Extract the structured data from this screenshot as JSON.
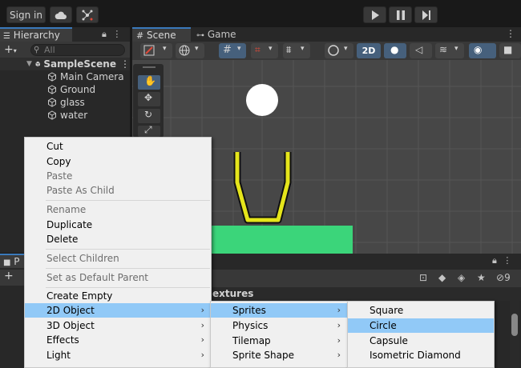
{
  "toolbar": {
    "signin_label": "Sign in",
    "cloud_icon": "cloud-icon",
    "collab_icon": "collab-icon",
    "play_icon": "play-icon",
    "pause_icon": "pause-icon",
    "step_icon": "step-icon"
  },
  "hierarchy": {
    "tab_label": "Hierarchy",
    "search_placeholder": "All",
    "scene_name": "SampleScene",
    "items": [
      {
        "label": "Main Camera"
      },
      {
        "label": "Ground"
      },
      {
        "label": "glass"
      },
      {
        "label": "water"
      }
    ]
  },
  "scene": {
    "tab_scene": "Scene",
    "tab_game": "Game",
    "mode_2d": "2D"
  },
  "project": {
    "tab_label": "P",
    "folder_label": "extures",
    "count_label": "9"
  },
  "context_menu": {
    "items": [
      {
        "label": "Cut",
        "disabled": false
      },
      {
        "label": "Copy",
        "disabled": false
      },
      {
        "label": "Paste",
        "disabled": true
      },
      {
        "label": "Paste As Child",
        "disabled": true
      },
      {
        "label": "Rename",
        "disabled": true
      },
      {
        "label": "Duplicate",
        "disabled": false
      },
      {
        "label": "Delete",
        "disabled": false
      },
      {
        "label": "Select Children",
        "disabled": true
      },
      {
        "label": "Set as Default Parent",
        "disabled": true
      },
      {
        "label": "Create Empty",
        "disabled": false
      },
      {
        "label": "2D Object",
        "disabled": false
      },
      {
        "label": "3D Object",
        "disabled": false
      },
      {
        "label": "Effects",
        "disabled": false
      },
      {
        "label": "Light",
        "disabled": false
      }
    ]
  },
  "submenu_2d": {
    "items": [
      {
        "label": "Sprites"
      },
      {
        "label": "Physics"
      },
      {
        "label": "Tilemap"
      },
      {
        "label": "Sprite Shape"
      }
    ]
  },
  "submenu_sprites": {
    "items": [
      {
        "label": "Square"
      },
      {
        "label": "Circle"
      },
      {
        "label": "Capsule"
      },
      {
        "label": "Isometric Diamond"
      }
    ]
  },
  "colors": {
    "accent": "#3a79bb",
    "menu_highlight": "#91c9f7",
    "ground_green": "#3bd57a",
    "glass_yellow": "#e5e51b"
  }
}
